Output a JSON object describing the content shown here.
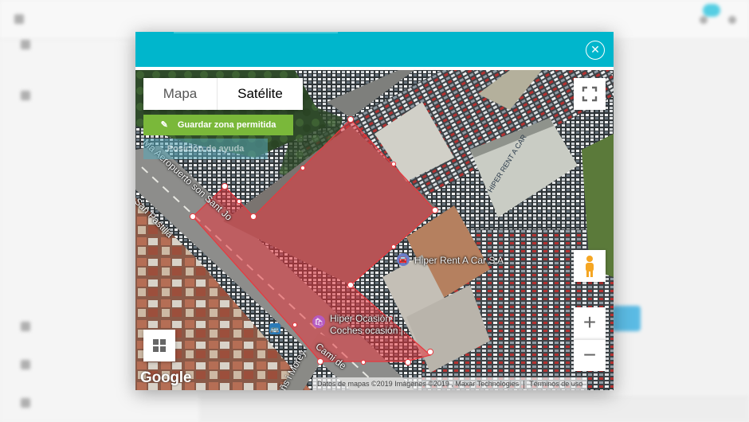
{
  "map": {
    "type_control": {
      "map_label": "Mapa",
      "satellite_label": "Satélite",
      "selected": "Satélite"
    },
    "save_button_label": "Guardar zona permitida",
    "help_button_label": "Posición de ayuda",
    "logo_text": "Google",
    "attribution": "Datos de mapas ©2019 Imágenes ©2019 , Maxar Technologies",
    "terms_label": "Términos de uso",
    "zoom_in_symbol": "+",
    "zoom_out_symbol": "−",
    "close_symbol": "✕",
    "pois": {
      "rent": "Hiper Rent A Car S A",
      "ocasion_1": "Hiper Ocasión |",
      "ocasion_2": "Coches ocasión |..."
    },
    "roads": {
      "road_1": "Cami de",
      "road_2": "Ma Aeropuerto son Sant Jo",
      "road_3": "San Pastilla",
      "road_4": "ñs i Morey",
      "road_5": "Cami de"
    },
    "building_sign": "HIPER RENT A CAR",
    "zone_color": "#e8393f"
  }
}
